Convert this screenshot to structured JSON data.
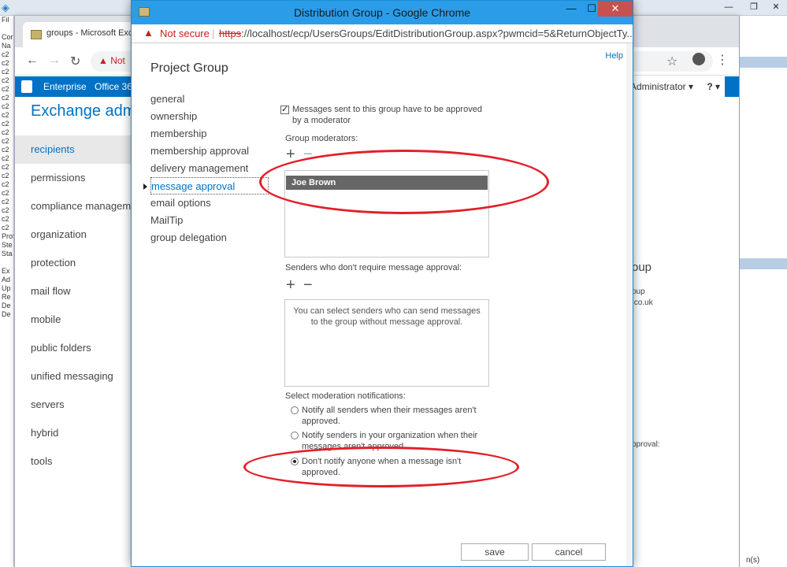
{
  "background_app": {
    "left_strip_rows": [
      "Fil",
      "",
      "Con",
      "Na",
      "c2",
      "c2",
      "c2",
      "c2",
      "c2",
      "c2",
      "c2",
      "c2",
      "c2",
      "c2",
      "c2",
      "c2",
      "c2",
      "c2",
      "c2",
      "c2",
      "c2",
      "c2",
      "c2",
      "c2",
      "c2",
      "Prof",
      "Ste",
      "Sta",
      "",
      "Ex",
      "Ad",
      "Up",
      "Re",
      "De",
      "De"
    ],
    "controls": {
      "minimize": "—",
      "restore": "❐",
      "close": "✕"
    }
  },
  "chrome_bg": {
    "tab_title": "groups - Microsoft Exc",
    "omnibox_text": "Not",
    "exchange_header": {
      "enterprise": "Enterprise",
      "office365": "Office 36"
    },
    "user_label": "Administrator ▾",
    "help_label": "? ▾",
    "eac_title": "Exchange admi",
    "nav": [
      "recipients",
      "permissions",
      "compliance manageme",
      "organization",
      "protection",
      "mail flow",
      "mobile",
      "public folders",
      "unified messaging",
      "servers",
      "hybrid",
      "tools"
    ],
    "right_panel": {
      "heading": "oup",
      "line1": "oup",
      "line2": ".co.uk",
      "line3": "pproval:",
      "bottom": "n(s)"
    }
  },
  "popup": {
    "window_title": "Distribution Group - Google Chrome",
    "controls": {
      "minimize": "—",
      "maximize": "☐",
      "close": "✕"
    },
    "address": {
      "warning_icon": "▲",
      "not_secure": "Not secure",
      "separator": "|",
      "scheme": "https",
      "url_rest": "://localhost/ecp/UsersGroups/EditDistributionGroup.aspx?pwmcid=5&ReturnObjectTy..."
    },
    "help": "Help",
    "group_title": "Project Group",
    "side_nav": [
      "general",
      "ownership",
      "membership",
      "membership approval",
      "delivery management",
      "message approval",
      "email options",
      "MailTip",
      "group delegation"
    ],
    "active_nav_index": 5,
    "approval_checkbox": {
      "checked": true,
      "label_line1": "Messages sent to this group have to be approved",
      "label_line2": "by a moderator"
    },
    "moderators_label": "Group moderators:",
    "moderators": [
      "Joe Brown"
    ],
    "senders_label": "Senders who don't require message approval:",
    "senders_hint": "You can select senders who can send messages to the group without message approval.",
    "notifications_label": "Select moderation notifications:",
    "notification_options": [
      {
        "line1": "Notify all senders when their messages aren't",
        "line2": "approved.",
        "selected": false
      },
      {
        "line1": "Notify senders in your organization when their",
        "line2": "messages aren't approved.",
        "selected": false
      },
      {
        "line1": "Don't notify anyone when a message isn't",
        "line2": "approved.",
        "selected": true
      }
    ],
    "save": "save",
    "cancel": "cancel",
    "add_icon_glyph": "+",
    "remove_icon_glyph": "−"
  },
  "colors": {
    "accent": "#0072c6",
    "popup_titlebar": "#2b9de8",
    "annotation": "#e3202a",
    "selected_row": "#666666"
  }
}
